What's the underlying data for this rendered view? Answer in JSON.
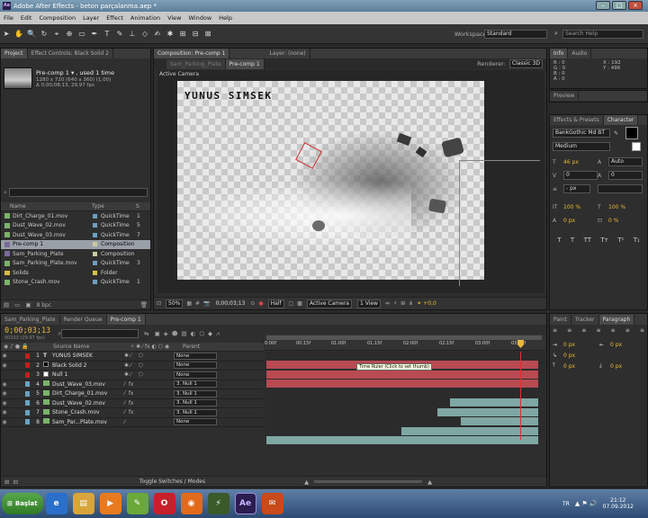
{
  "window": {
    "title": "Adobe After Effects - beton parçalanma.aep *"
  },
  "menu": [
    "File",
    "Edit",
    "Composition",
    "Layer",
    "Effect",
    "Animation",
    "View",
    "Window",
    "Help"
  ],
  "toolbar": {
    "workspace_label": "Workspace:",
    "workspace_value": "Standard",
    "search_placeholder": "Search Help"
  },
  "project": {
    "tabs": [
      "Project",
      "Effect Controls: Black Solid 2"
    ],
    "selected_name": "Pre-comp 1 ▾ , used 1 time",
    "selected_info1": "1280 x 720 (640 x 360) (1,00)",
    "selected_info2": "Δ 0;00;08;13, 29,97 fps",
    "search_value": "",
    "columns": {
      "name": "Name",
      "type": "Type",
      "size": "S"
    },
    "items": [
      {
        "name": "Dirt_Charge_01.mov",
        "type": "QuickTime",
        "size": "1",
        "color": "#6aa0c0"
      },
      {
        "name": "Dust_Wave_02.mov",
        "type": "QuickTime",
        "size": "5",
        "color": "#6aa0c0"
      },
      {
        "name": "Dust_Wave_03.mov",
        "type": "QuickTime",
        "size": "7",
        "color": "#6aa0c0"
      },
      {
        "name": "Pre-comp 1",
        "type": "Composition",
        "size": "",
        "color": "#c9c9a0"
      },
      {
        "name": "Sam_Parking_Plate",
        "type": "Composition",
        "size": "",
        "color": "#c9c9a0"
      },
      {
        "name": "Sam_Parking_Plate.mov",
        "type": "QuickTime",
        "size": "3",
        "color": "#6aa0c0"
      },
      {
        "name": "Solids",
        "type": "Folder",
        "size": "",
        "color": "#d8c24a"
      },
      {
        "name": "Stone_Crash.mov",
        "type": "QuickTime",
        "size": "1",
        "color": "#6aa0c0"
      }
    ],
    "bpc": "8 bpc"
  },
  "composition": {
    "tabs": [
      "Composition: Pre-comp 1",
      "Layer: (none)"
    ],
    "subtabs": [
      "Sam_Parking_Plate",
      "Pre-comp 1"
    ],
    "renderer_label": "Renderer:",
    "renderer_value": "Classic 3D",
    "active_camera": "Active Camera",
    "overlay_text": "YUNUS SIMSEK",
    "zoom": "50%",
    "timecode": "0;00;03;13",
    "resolution": "Half",
    "camera_select": "Active Camera",
    "view_select": "1 View",
    "exposure": "+0,0"
  },
  "right_panel": {
    "info_tabs": [
      "Info",
      "Audio"
    ],
    "info_values": {
      "r": "R : 0",
      "g": "G : 0",
      "b": "B : 0",
      "a": "A : 0",
      "x": "X : 192",
      "y": "Y : 496"
    },
    "preview_tab": "Preview",
    "char_tabs": [
      "Effects & Presets",
      "Character"
    ],
    "font": "BankGothic Md BT",
    "style": "Medium",
    "font_size": "46 px",
    "leading": "Auto",
    "kerning": "0",
    "tracking": "0",
    "stroke_width": "- px",
    "vert_scale": "100 %",
    "horiz_scale": "100 %",
    "baseline": "0 px",
    "tsume": "0 %",
    "para_tabs": [
      "Paint",
      "Tracker",
      "Paragraph"
    ],
    "para_values": [
      "0 px",
      "0 px",
      "0 px",
      "0 px",
      "0 px"
    ]
  },
  "timeline": {
    "tabs": [
      "Sam_Parking_Plate",
      "Render Queue",
      "Pre-comp 1"
    ],
    "timecode": "0;00;03;13",
    "fps": "00103 (29.97 fps)",
    "search_value": "",
    "columns": {
      "source": "Source Name",
      "parent": "Parent"
    },
    "ruler": [
      "0:00f",
      "00:15f",
      "01:00f",
      "01:15f",
      "02:00f",
      "02:15f",
      "03:00f",
      "03:15f"
    ],
    "tooltip": "Time Ruler (Click to set thumb)",
    "toggle_label": "Toggle Switches / Modes",
    "layers": [
      {
        "num": "1",
        "name": "YUNUS SIMSEK",
        "parent": "None",
        "color": "#c02020",
        "type": "text"
      },
      {
        "num": "2",
        "name": "Black Solid 2",
        "parent": "None",
        "color": "#c02020",
        "type": "solid"
      },
      {
        "num": "3",
        "name": "Null 1",
        "parent": "None",
        "color": "#c02020",
        "type": "null"
      },
      {
        "num": "4",
        "name": "Dust_Wave_03.mov",
        "parent": "3. Null 1",
        "color": "#6aa0c0",
        "type": "footage"
      },
      {
        "num": "5",
        "name": "Dirt_Charge_01.mov",
        "parent": "3. Null 1",
        "color": "#6aa0c0",
        "type": "footage"
      },
      {
        "num": "6",
        "name": "Dust_Wave_02.mov",
        "parent": "3. Null 1",
        "color": "#6aa0c0",
        "type": "footage"
      },
      {
        "num": "7",
        "name": "Stone_Crash.mov",
        "parent": "3. Null 1",
        "color": "#6aa0c0",
        "type": "footage"
      },
      {
        "num": "8",
        "name": "Sam_Par...Plate.mov",
        "parent": "None",
        "color": "#6aa0c0",
        "type": "footage"
      }
    ]
  },
  "taskbar": {
    "start_label": "Başlat",
    "lang": "TR",
    "time": "21:12",
    "date": "07.09.2012",
    "apps": [
      "ie",
      "explorer",
      "media",
      "paint",
      "opera",
      "firefox",
      "winamp",
      "ae",
      "office"
    ]
  }
}
